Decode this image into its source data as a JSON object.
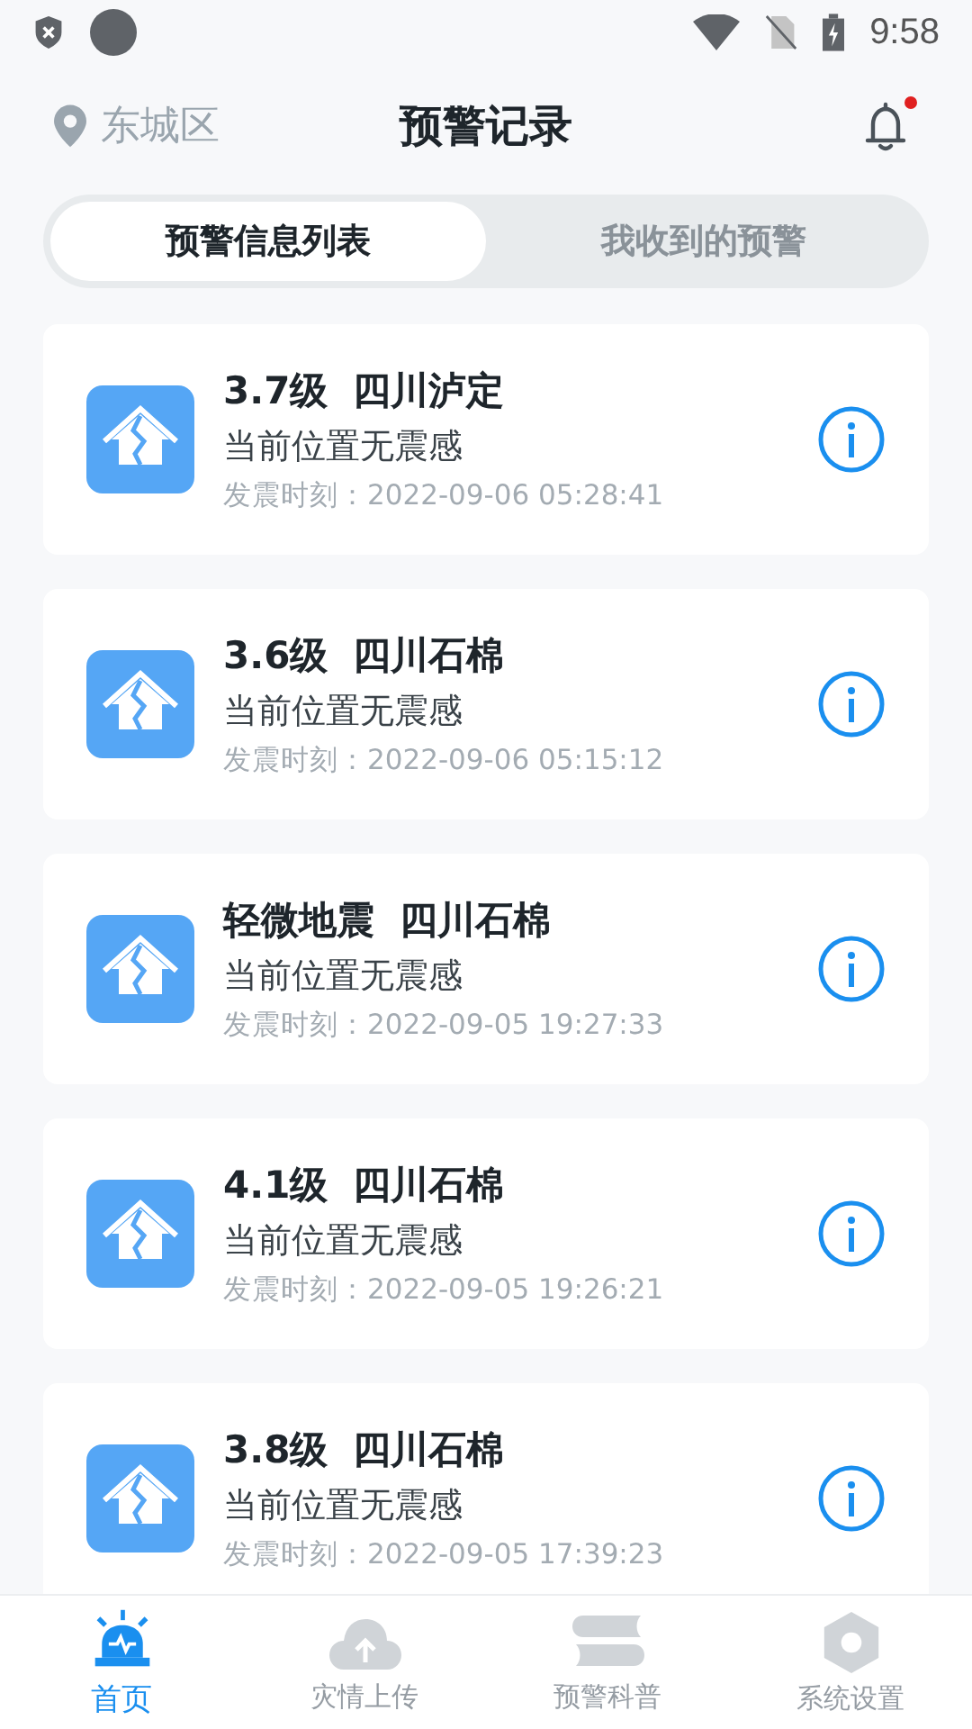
{
  "status_bar": {
    "time": "9:58"
  },
  "header": {
    "location": "东城区",
    "title": "预警记录",
    "has_unread": true
  },
  "tabs": [
    {
      "label": "预警信息列表",
      "selected": true
    },
    {
      "label": "我收到的预警",
      "selected": false
    }
  ],
  "records": [
    {
      "magnitude": "3.7级",
      "place": "四川泸定",
      "felt": "当前位置无震感",
      "time": "发震时刻：2022-09-06 05:28:41"
    },
    {
      "magnitude": "3.6级",
      "place": "四川石棉",
      "felt": "当前位置无震感",
      "time": "发震时刻：2022-09-06 05:15:12"
    },
    {
      "magnitude": "轻微地震",
      "place": "四川石棉",
      "felt": "当前位置无震感",
      "time": "发震时刻：2022-09-05 19:27:33"
    },
    {
      "magnitude": "4.1级",
      "place": "四川石棉",
      "felt": "当前位置无震感",
      "time": "发震时刻：2022-09-05 19:26:21"
    },
    {
      "magnitude": "3.8级",
      "place": "四川石棉",
      "felt": "当前位置无震感",
      "time": "发震时刻：2022-09-05 17:39:23"
    }
  ],
  "nav": [
    {
      "kind": "alarm",
      "label": "首页",
      "selected": true
    },
    {
      "kind": "upload",
      "label": "灾情上传",
      "selected": false
    },
    {
      "kind": "book",
      "label": "预警科普",
      "selected": false
    },
    {
      "kind": "settings",
      "label": "系统设置",
      "selected": false
    }
  ]
}
